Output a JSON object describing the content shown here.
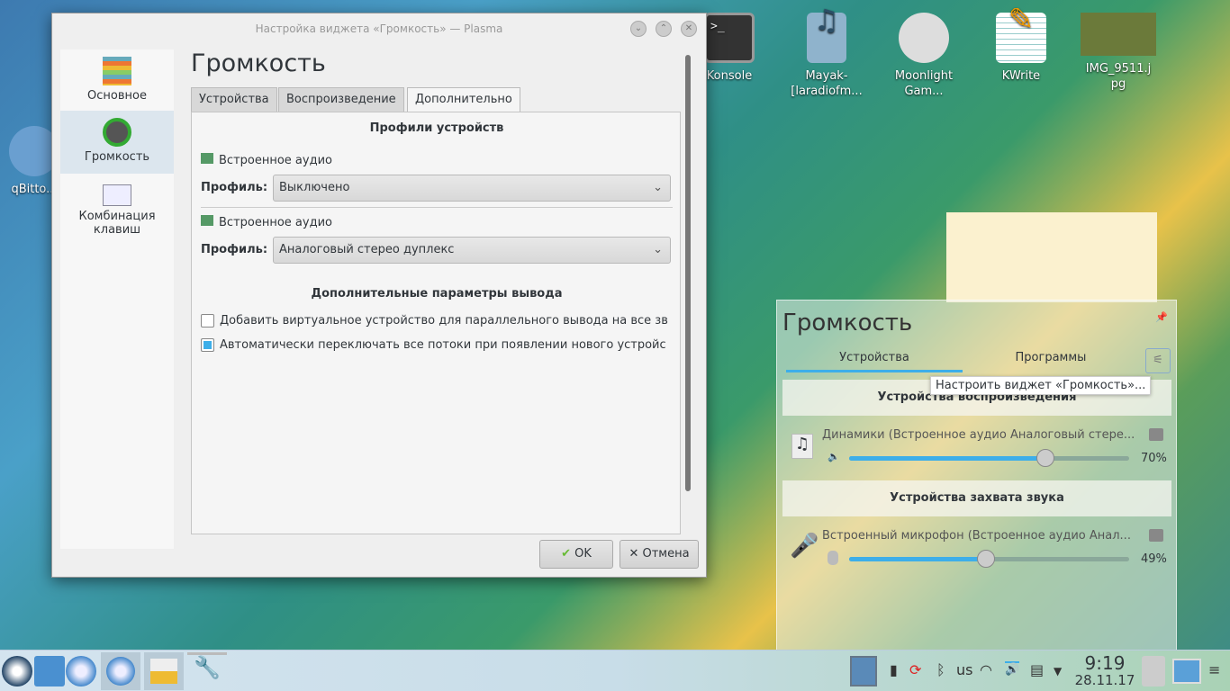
{
  "desktop": {
    "icons": [
      {
        "label": "qBitto..."
      },
      {
        "label": "Konsole"
      },
      {
        "label": "Mayak-\n[laradiofm..."
      },
      {
        "label": "Moonlight\nGam..."
      },
      {
        "label": "KWrite"
      },
      {
        "label": "IMG_9511.j\npg"
      }
    ]
  },
  "dialog": {
    "title": "Настройка виджета «Громкость» — Plasma",
    "sidebar": [
      {
        "label": "Основное"
      },
      {
        "label": "Громкость"
      },
      {
        "label": "Комбинация клавиш"
      }
    ],
    "heading": "Громкость",
    "tabs": [
      {
        "label": "Устройства"
      },
      {
        "label": "Воспроизведение"
      },
      {
        "label": "Дополнительно"
      }
    ],
    "profiles_heading": "Профили устройств",
    "devices": [
      {
        "name": "Встроенное аудио",
        "profile_label": "Профиль:",
        "profile": "Выключено"
      },
      {
        "name": "Встроенное аудио",
        "profile_label": "Профиль:",
        "profile": "Аналоговый стерео дуплекс"
      }
    ],
    "extra_heading": "Дополнительные параметры вывода",
    "options": [
      {
        "label": "Добавить виртуальное устройство для параллельного вывода на все зв",
        "checked": false
      },
      {
        "label": "Автоматически переключать все потоки при появлении нового устройс",
        "checked": true
      }
    ],
    "ok": "OK",
    "cancel": "Отмена"
  },
  "popup": {
    "title": "Громкость",
    "tabs": [
      {
        "label": "Устройства"
      },
      {
        "label": "Программы"
      }
    ],
    "tooltip": "Настроить виджет «Громкость»...",
    "playback_heading": "Устройства воспроизведения",
    "playback": {
      "name": "Динамики (Встроенное аудио Аналоговый стере...",
      "volume": 70,
      "volume_text": "70%"
    },
    "capture_heading": "Устройства захвата звука",
    "capture": {
      "name": "Встроенный микрофон (Встроенное аудио Анал...",
      "volume": 49,
      "volume_text": "49%"
    }
  },
  "taskbar": {
    "keyboard_layout": "us",
    "time": "9:19",
    "date": "28.11.17"
  },
  "colors": {
    "accent": "#3daee9"
  }
}
